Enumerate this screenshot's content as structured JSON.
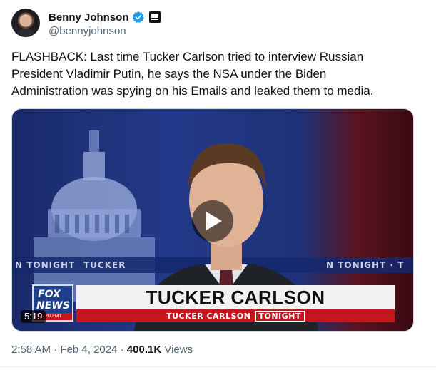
{
  "author": {
    "name": "Benny Johnson",
    "handle": "@bennyjohnson",
    "verified_icon": "verified-badge-icon",
    "affiliate_icon": "affiliate-badge-icon",
    "verified_color": "#1d9bf0"
  },
  "tweet": {
    "text": "FLASHBACK: Last time Tucker Carlson tried to interview Russian\nPresident Vladimir Putin, he says the NSA under the Biden\nAdministration was spying on his Emails and leaked them to media."
  },
  "media": {
    "duration": "5:19",
    "play_icon": "play-icon",
    "lower_third_title": "TUCKER CARLSON",
    "lower_third_show": "TUCKER CARLSON",
    "lower_third_tag": "TONIGHT",
    "ticker_left": "N TONIGHT",
    "ticker_mid": "TUCKER",
    "ticker_right": "N TONIGHT  ·  T",
    "logo_line1": "FOX",
    "logo_line2": "NEWS",
    "logo_line3": "200 MT"
  },
  "meta": {
    "time": "2:58 AM",
    "sep1": " · ",
    "date": "Feb 4, 2024",
    "sep2": " · ",
    "views_count": "400.1K",
    "views_label": " Views"
  }
}
